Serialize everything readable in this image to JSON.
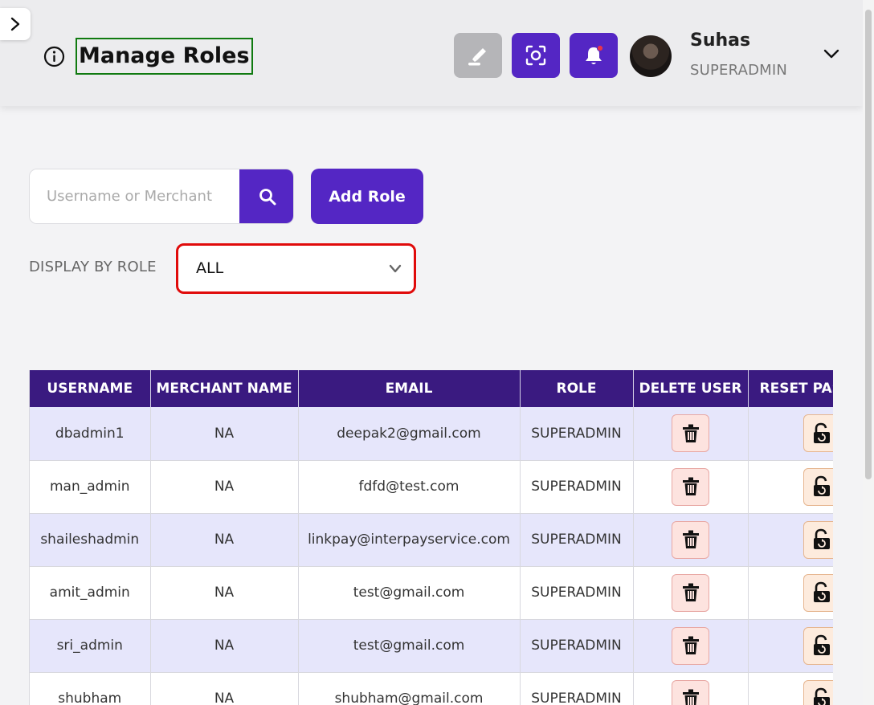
{
  "header": {
    "title": "Manage Roles",
    "user": {
      "name": "Suhas",
      "role": "SUPERADMIN"
    }
  },
  "search": {
    "placeholder": "Username or Merchant",
    "value": ""
  },
  "actions": {
    "add_role_label": "Add Role"
  },
  "filter": {
    "label": "DISPLAY BY ROLE",
    "selected": "ALL"
  },
  "table": {
    "headers": [
      "USERNAME",
      "MERCHANT NAME",
      "EMAIL",
      "ROLE",
      "DELETE USER",
      "RESET PASSWORD"
    ],
    "rows": [
      {
        "username": "dbadmin1",
        "merchant": "NA",
        "email": "deepak2@gmail.com",
        "role": "SUPERADMIN"
      },
      {
        "username": "man_admin",
        "merchant": "NA",
        "email": "fdfd@test.com",
        "role": "SUPERADMIN"
      },
      {
        "username": "shaileshadmin",
        "merchant": "NA",
        "email": "linkpay@interpayservice.com",
        "role": "SUPERADMIN"
      },
      {
        "username": "amit_admin",
        "merchant": "NA",
        "email": "test@gmail.com",
        "role": "SUPERADMIN"
      },
      {
        "username": "sri_admin",
        "merchant": "NA",
        "email": "test@gmail.com",
        "role": "SUPERADMIN"
      },
      {
        "username": "shubham",
        "merchant": "NA",
        "email": "shubham@gmail.com",
        "role": "SUPERADMIN"
      }
    ]
  },
  "icons": {
    "sidebar_toggle": "chevron-right-icon",
    "info": "info-icon",
    "highlighter": "highlighter-icon",
    "scan": "scan-icon",
    "bell": "bell-icon",
    "user_menu": "chevron-down-icon",
    "search": "search-icon",
    "select": "chevron-down-icon",
    "delete": "trash-icon",
    "reset": "unlock-icon"
  },
  "colors": {
    "accent": "#5426c4",
    "table_header": "#3a1a80",
    "title_outline": "#107a10",
    "select_outline": "#e00b0b",
    "row_stripe": "#e6e6fb",
    "notification_dot": "#e8344a"
  }
}
